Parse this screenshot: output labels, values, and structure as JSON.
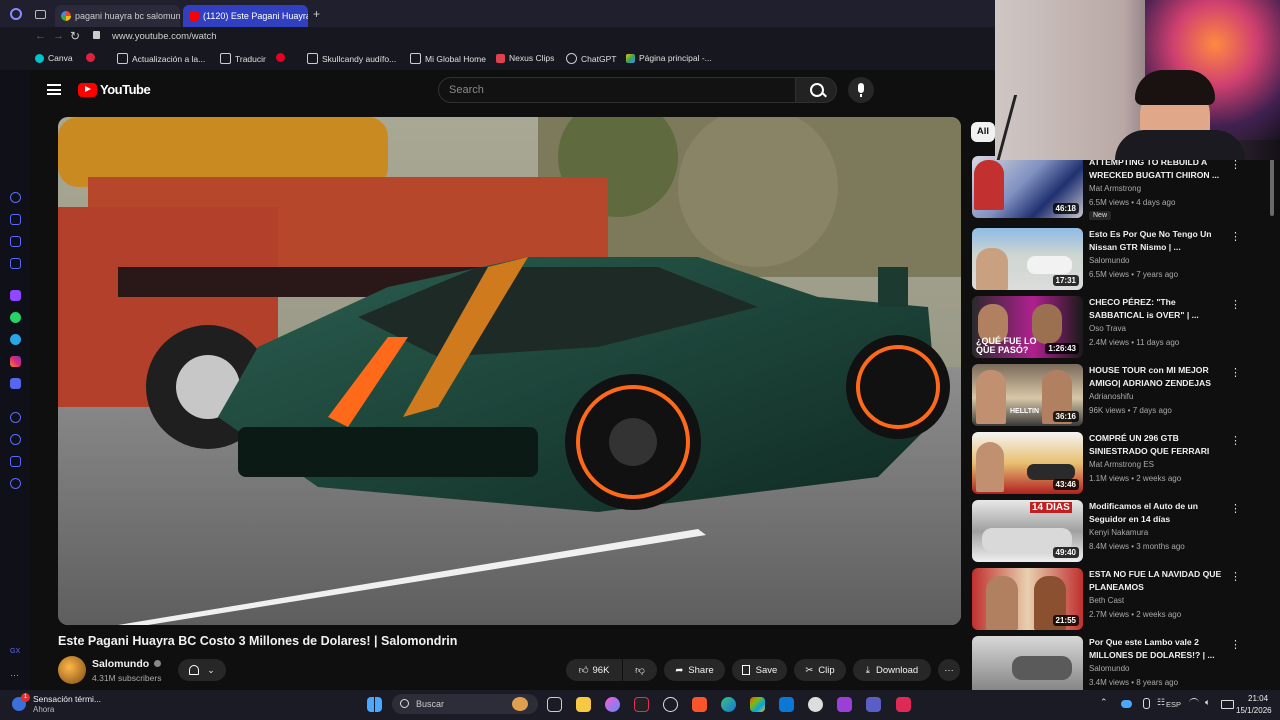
{
  "browser": {
    "tabs": [
      {
        "title": "pagani huayra bc salomun",
        "active": false
      },
      {
        "title": "(1120) Este Pagani Huayra",
        "active": true
      }
    ],
    "url": "www.youtube.com/watch",
    "bookmarks": [
      "Canva",
      "Actualización a la...",
      "Traducir",
      "Skullcandy audífo...",
      "Mi Global Home",
      "Nexus Clips",
      "ChatGPT",
      "Página principal -..."
    ]
  },
  "youtube": {
    "logo": "YouTube",
    "search_placeholder": "Search",
    "filter_chip": "All"
  },
  "video": {
    "title": "Este Pagani Huayra BC Costo 3 Millones de Dolares! | Salomondrin",
    "channel": "Salomundo",
    "subscribers": "4.31M subscribers",
    "likes": "96K",
    "actions": {
      "share": "Share",
      "save": "Save",
      "clip": "Clip",
      "download": "Download"
    }
  },
  "recommendations": [
    {
      "title": "ATTEMPTING TO REBUILD A WRECKED BUGATTI CHIRON ...",
      "channel": "Mat Armstrong",
      "meta": "6.5M views • 4 days ago",
      "duration": "46:18",
      "badge": "New"
    },
    {
      "title": "Esto Es Por Que No Tengo Un Nissan GTR Nismo | ...",
      "channel": "Salomundo",
      "meta": "6.5M views • 7 years ago",
      "duration": "17:31"
    },
    {
      "title": "CHECO PÉREZ: \"The SABBATICAL is OVER\" | ...",
      "channel": "Oso Trava",
      "meta": "2.4M views • 11 days ago",
      "duration": "1:26:43",
      "thumb_text": "¿QUÉ FUE LO QUE PASÓ?"
    },
    {
      "title": "HOUSE TOUR con MI MEJOR AMIGO| ADRIANO ZENDEJAS",
      "channel": "Adrianoshifu",
      "meta": "96K views • 7 days ago",
      "duration": "36:16",
      "thumb_text": "HELLTIN"
    },
    {
      "title": "COMPRÉ UN 296 GTB SINIESTRADO QUE FERRARI N...",
      "channel": "Mat Armstrong ES",
      "meta": "1.1M views • 2 weeks ago",
      "duration": "43:46"
    },
    {
      "title": "Modificamos el Auto de un Seguidor en 14 días",
      "channel": "Kenyi Nakamura",
      "meta": "8.4M views • 3 months ago",
      "duration": "49:40",
      "thumb_text": "14 DÍAS"
    },
    {
      "title": "ESTA NO FUE LA NAVIDAD QUE PLANEAMOS",
      "channel": "Beth Cast",
      "meta": "2.7M views • 2 weeks ago",
      "duration": "21:55"
    },
    {
      "title": "Por Que este Lambo vale 2 MILLONES DE DOLARES!? | ...",
      "channel": "Salomundo",
      "meta": "3.4M views • 8 years ago",
      "duration": ""
    }
  ],
  "taskbar": {
    "notification_title": "Sensación térmi...",
    "notification_sub": "Ahora",
    "notification_count": "1",
    "search_placeholder": "Buscar",
    "lang": "ESP",
    "time": "21:04",
    "date": "15/1/2026"
  },
  "colors": {
    "yt_red": "#ff0000",
    "bg": "#0f0f0f",
    "car_green": "#1f4a3c",
    "accent_orange": "#ff6a1a"
  }
}
